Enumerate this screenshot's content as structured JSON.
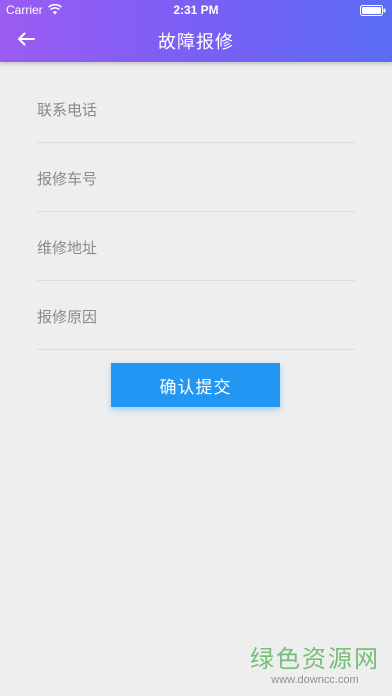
{
  "status_bar": {
    "carrier": "Carrier",
    "time": "2:31 PM"
  },
  "header": {
    "title": "故障报修",
    "back_icon": "back-arrow-icon"
  },
  "form": {
    "phone_placeholder": "联系电话",
    "car_number_placeholder": "报修车号",
    "address_placeholder": "维修地址",
    "reason_placeholder": "报修原因"
  },
  "actions": {
    "submit_label": "确认提交"
  },
  "watermark": {
    "title": "绿色资源网",
    "url": "www.downcc.com"
  },
  "colors": {
    "header_gradient_start": "#9b5cf2",
    "header_gradient_end": "#5b6cf4",
    "button": "#2196f3",
    "background": "#eeeeee"
  }
}
